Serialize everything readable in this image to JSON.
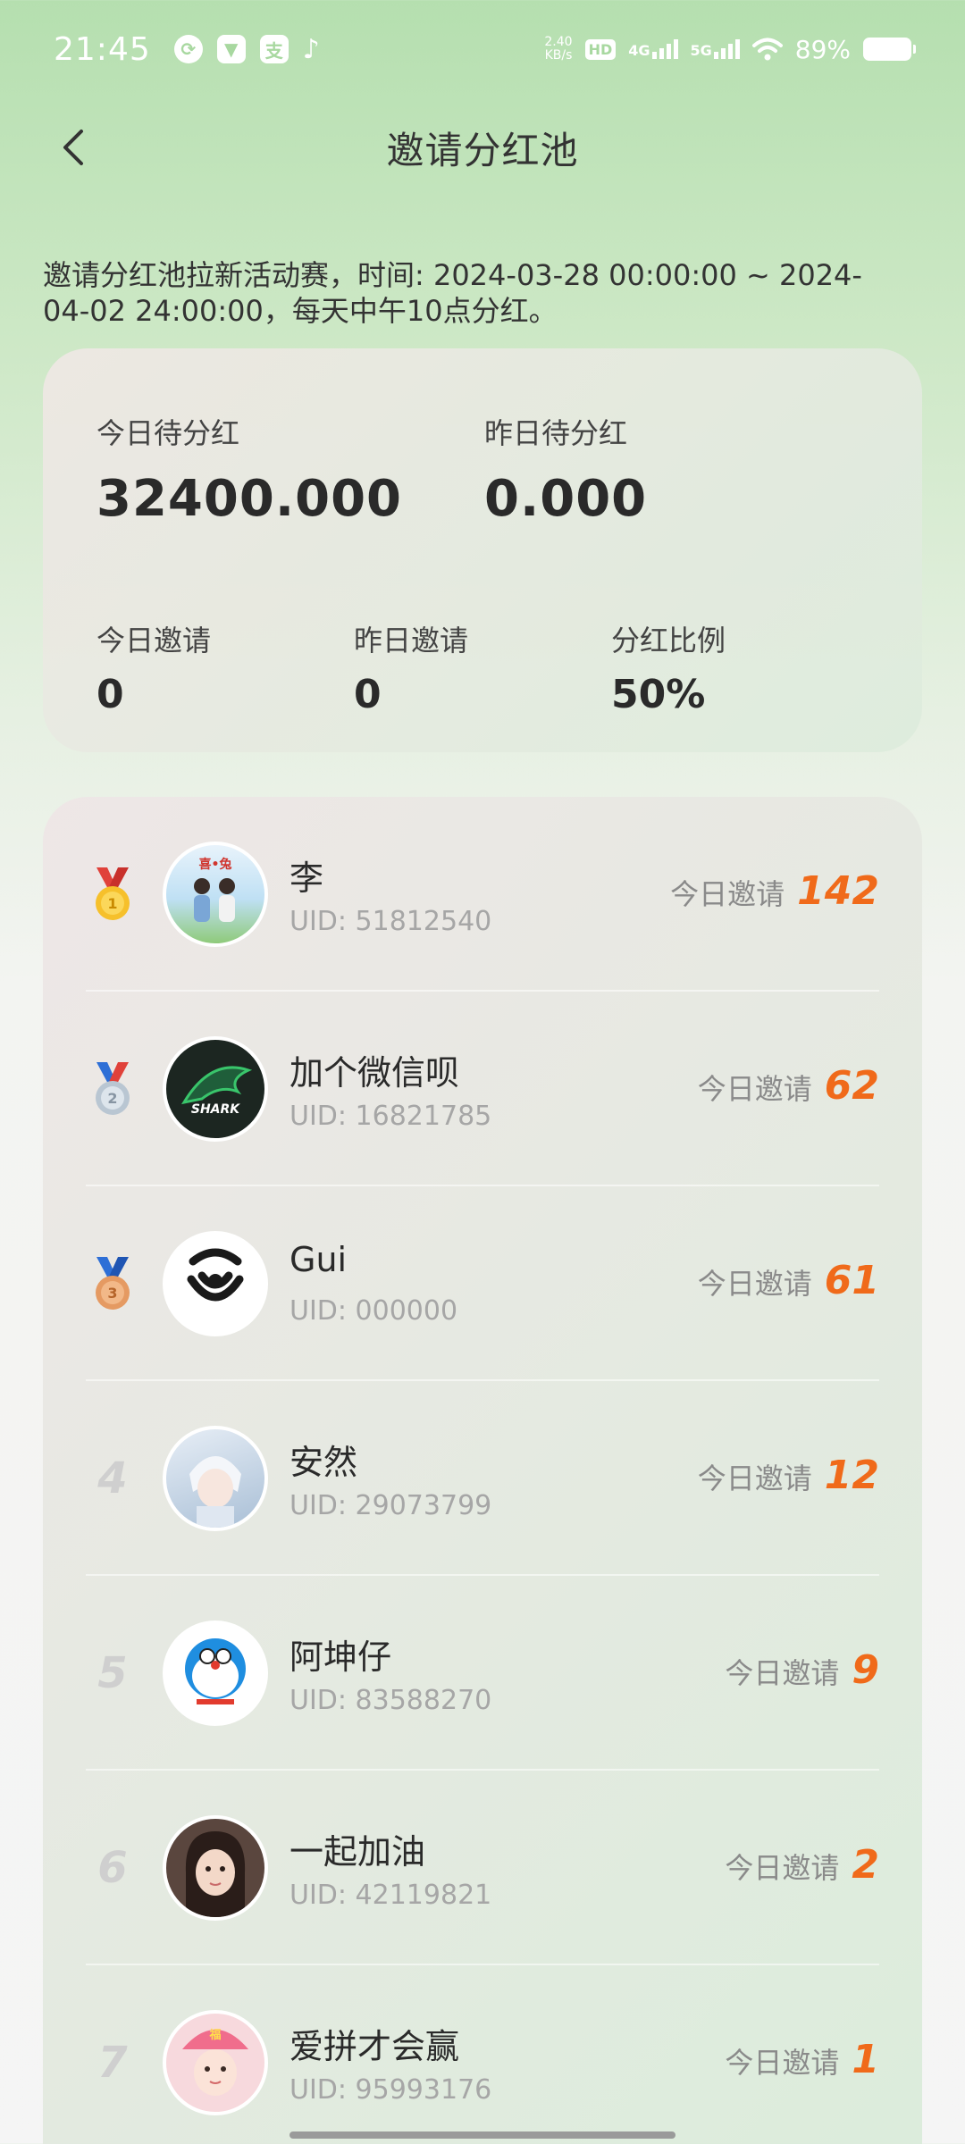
{
  "status_bar": {
    "time": "21:45",
    "speed_value": "2.40",
    "speed_unit": "KB/s",
    "hd": "HD",
    "net1": "4G",
    "net2": "5G",
    "battery": "89%"
  },
  "nav": {
    "title": "邀请分红池"
  },
  "notice": "邀请分红池拉新活动赛，时间: 2024-03-28 00:00:00 ~ 2024-04-02 24:00:00，每天中午10点分红。",
  "stats": {
    "today_pending_label": "今日待分红",
    "today_pending_value": "32400.000",
    "yesterday_pending_label": "昨日待分红",
    "yesterday_pending_value": "0.000",
    "today_invite_label": "今日邀请",
    "today_invite_value": "0",
    "yesterday_invite_label": "昨日邀请",
    "yesterday_invite_value": "0",
    "ratio_label": "分红比例",
    "ratio_value": "50%"
  },
  "ranking": [
    {
      "rank": "1",
      "name": "李",
      "uid": "UID: 51812540",
      "invite_label": "今日邀请",
      "count": "142",
      "medal": "gold",
      "avatar_color": "#9cc8e8"
    },
    {
      "rank": "2",
      "name": "加个微信呗",
      "uid": "UID: 16821785",
      "invite_label": "今日邀请",
      "count": "62",
      "medal": "silver",
      "avatar_color": "#1e2a24"
    },
    {
      "rank": "3",
      "name": "Gui",
      "uid": "UID: 000000",
      "invite_label": "今日邀请",
      "count": "61",
      "medal": "bronze",
      "avatar_color": "#ffffff"
    },
    {
      "rank": "4",
      "name": "安然",
      "uid": "UID: 29073799",
      "invite_label": "今日邀请",
      "count": "12",
      "medal": "",
      "avatar_color": "#c9d7e6"
    },
    {
      "rank": "5",
      "name": "阿坤仔",
      "uid": "UID: 83588270",
      "invite_label": "今日邀请",
      "count": "9",
      "medal": "",
      "avatar_color": "#ffffff"
    },
    {
      "rank": "6",
      "name": "一起加油",
      "uid": "UID: 42119821",
      "invite_label": "今日邀请",
      "count": "2",
      "medal": "",
      "avatar_color": "#6b5a52"
    },
    {
      "rank": "7",
      "name": "爱拼才会赢",
      "uid": "UID: 95993176",
      "invite_label": "今日邀请",
      "count": "1",
      "medal": "",
      "avatar_color": "#f3c6cc"
    }
  ],
  "colors": {
    "accent_orange": "#f06a1a",
    "gold": "#f6c02b",
    "silver": "#cfd6de",
    "bronze": "#e59a62",
    "ribbon_red": "#e0413a",
    "ribbon_blue": "#2e6fd6"
  }
}
